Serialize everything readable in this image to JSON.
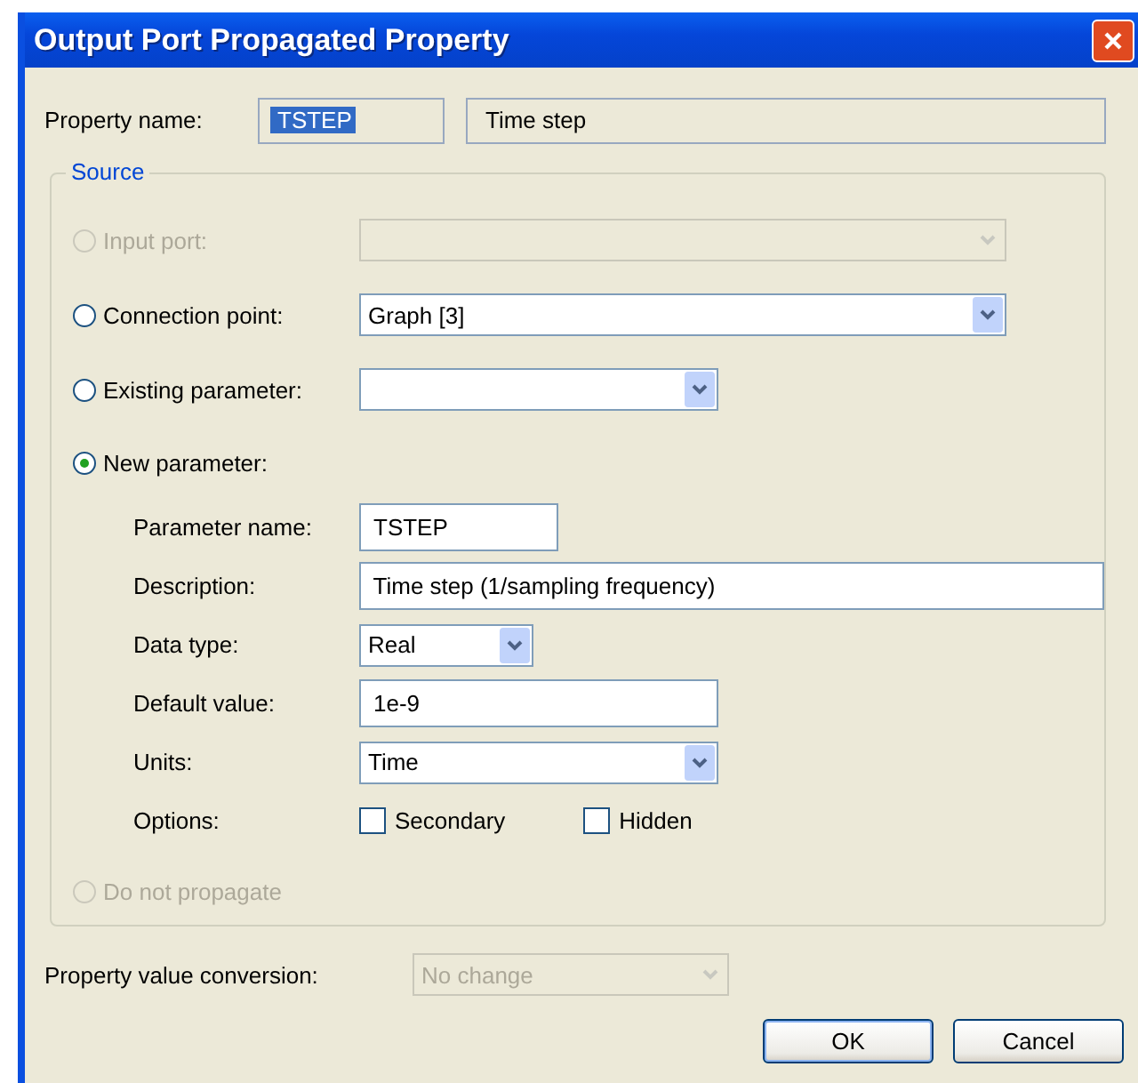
{
  "window": {
    "title": "Output Port Propagated Property"
  },
  "property_name": {
    "label": "Property name:",
    "value": "TSTEP",
    "value_selected": true,
    "description": "Time step"
  },
  "source": {
    "title": "Source",
    "options": [
      {
        "kind": "combo",
        "label": "Input port:",
        "selected": false,
        "disabled": true
      },
      {
        "kind": "combo",
        "label": "Connection point:",
        "selected": false,
        "disabled": false,
        "value": "Graph [3]"
      },
      {
        "kind": "combo",
        "label": "Existing parameter:",
        "selected": false,
        "disabled": false
      },
      {
        "kind": "group",
        "label": "New parameter:",
        "selected": true,
        "disabled": false,
        "fields": [
          {
            "kind": "text",
            "label": "Parameter name:",
            "value": "TSTEP"
          },
          {
            "kind": "text",
            "label": "Description:",
            "value": "Time step (1/sampling frequency)"
          },
          {
            "kind": "combo",
            "label": "Data type:",
            "value": "Real"
          },
          {
            "kind": "text",
            "label": "Default value:",
            "value": "1e-9"
          },
          {
            "kind": "combo",
            "label": "Units:",
            "value": "Time"
          },
          {
            "kind": "checks",
            "label": "Options:",
            "checks": [
              {
                "label": "Secondary",
                "checked": false
              },
              {
                "label": "Hidden",
                "checked": false
              }
            ]
          }
        ]
      },
      {
        "kind": "plain",
        "label": "Do not propagate",
        "selected": false,
        "disabled": true
      }
    ]
  },
  "conversion": {
    "label": "Property value conversion:",
    "value": "No change",
    "disabled": true
  },
  "buttons": [
    {
      "label": "OK",
      "default": true
    },
    {
      "label": "Cancel",
      "default": false
    }
  ]
}
